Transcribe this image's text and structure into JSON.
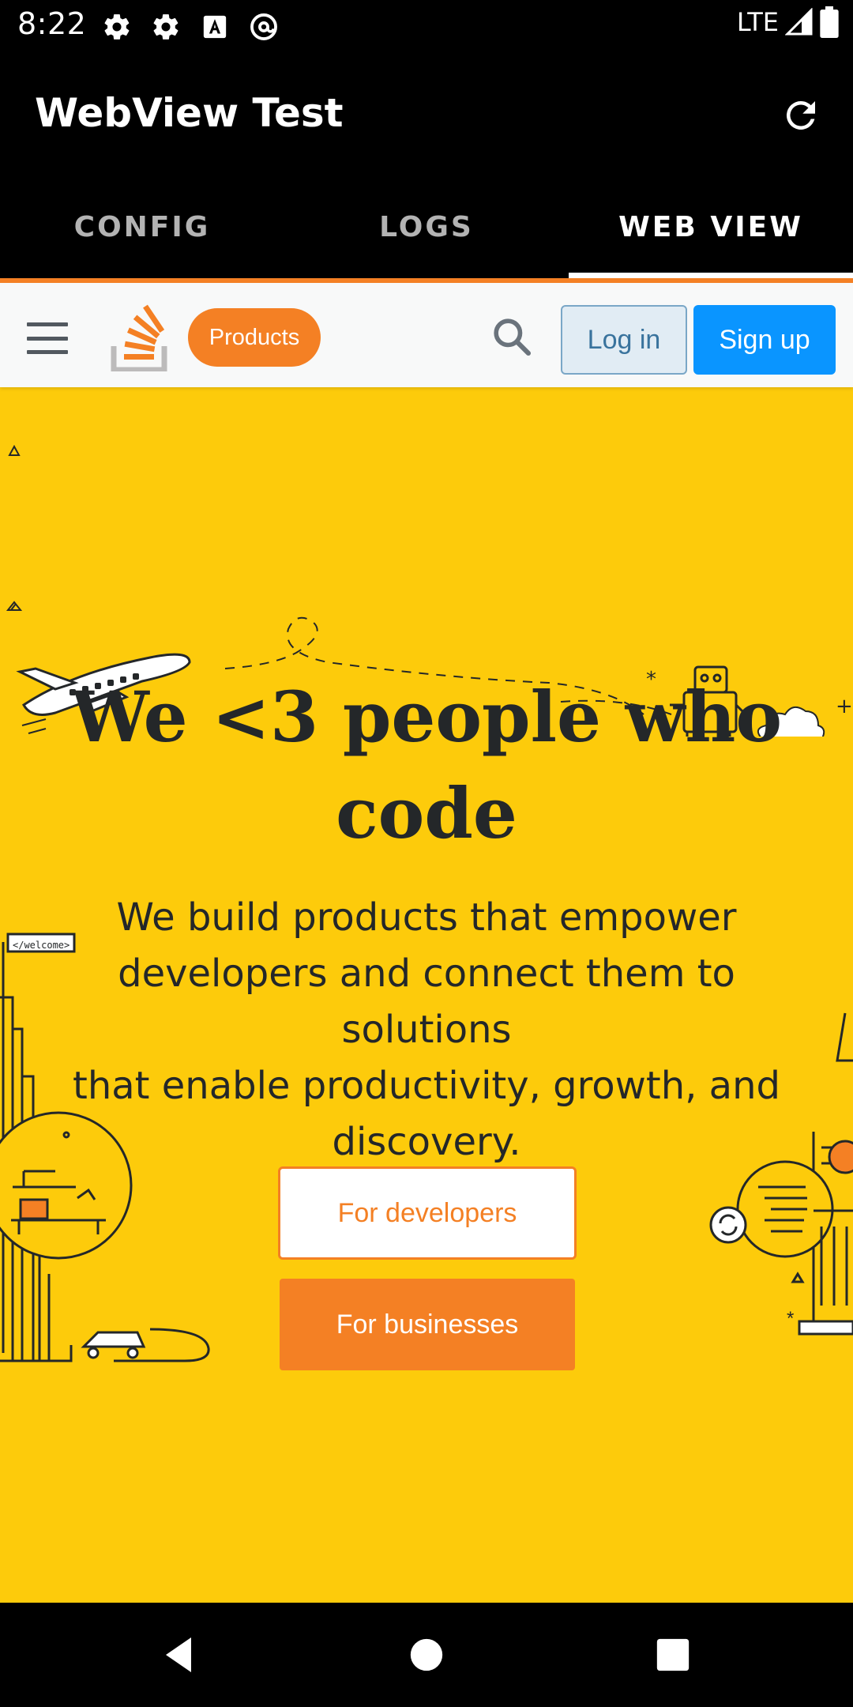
{
  "status_bar": {
    "time": "8:22",
    "left_icons": [
      "settings-icon",
      "settings-icon",
      "a-box-icon",
      "at-icon"
    ],
    "network": "LTE",
    "right_icons": [
      "signal-icon",
      "battery-icon"
    ]
  },
  "app_bar": {
    "title": "WebView Test",
    "refresh_icon": "refresh-icon"
  },
  "tabs": [
    {
      "label": "CONFIG",
      "active": false
    },
    {
      "label": "LOGS",
      "active": false
    },
    {
      "label": "WEB VIEW",
      "active": true
    }
  ],
  "site": {
    "header": {
      "menu_icon": "hamburger-icon",
      "logo": "stack-overflow-logo",
      "products_label": "Products",
      "search_icon": "search-icon",
      "login_label": "Log in",
      "signup_label": "Sign up"
    },
    "hero": {
      "title_line1": "We <3 people who",
      "title_line2": "code",
      "subtitle_lines": [
        "We build products that empower",
        "developers and connect them to solutions",
        "that enable productivity, growth, and",
        "discovery."
      ],
      "developers_button": "For developers",
      "businesses_button": "For businesses",
      "sign_text": "</welcome>"
    }
  },
  "nav_bar": {
    "back_icon": "back-icon",
    "home_icon": "home-icon",
    "recents_icon": "recents-icon"
  },
  "colors": {
    "accent_orange": "#f48024",
    "hero_yellow": "#fdcb0b",
    "signup_blue": "#0a95ff",
    "login_bg": "#e1ecf4"
  }
}
